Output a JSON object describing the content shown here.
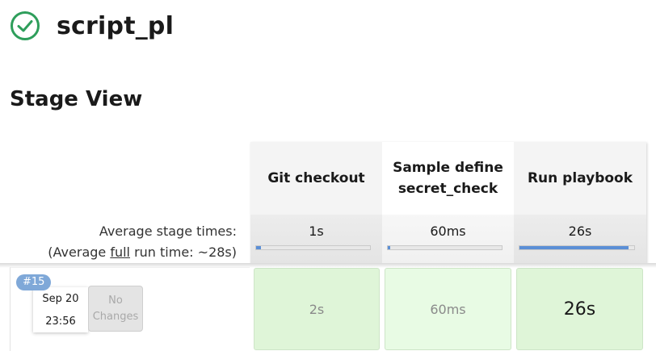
{
  "job": {
    "title": "script_pl",
    "status_icon": "success-check-icon",
    "status_color": "#2e9e5b"
  },
  "stage_view": {
    "title": "Stage View",
    "avg_label_line1": "Average stage times:",
    "avg_label_prefix": "(Average ",
    "avg_label_full": "full",
    "avg_label_suffix": " run time: ~28s)",
    "stages": [
      {
        "name": "Git checkout",
        "avg_time": "1s",
        "avg_fraction": 0.04
      },
      {
        "name": "Sample define secret_check",
        "name_line1": "Sample define",
        "name_line2": "secret_check",
        "avg_time": "60ms",
        "avg_fraction": 0.02
      },
      {
        "name": "Run playbook",
        "avg_time": "26s",
        "avg_fraction": 0.95
      }
    ],
    "builds": [
      {
        "badge": "#15",
        "date": "Sep 20",
        "time": "23:56",
        "changes_line1": "No",
        "changes_line2": "Changes",
        "stage_times": [
          "2s",
          "60ms",
          "26s"
        ]
      }
    ],
    "colors": {
      "success_cell": "#dff5d8",
      "success_cell_light": "#e8fbe4",
      "progress_fill": "#5b8fd6",
      "badge": "#7fa8d8"
    }
  }
}
